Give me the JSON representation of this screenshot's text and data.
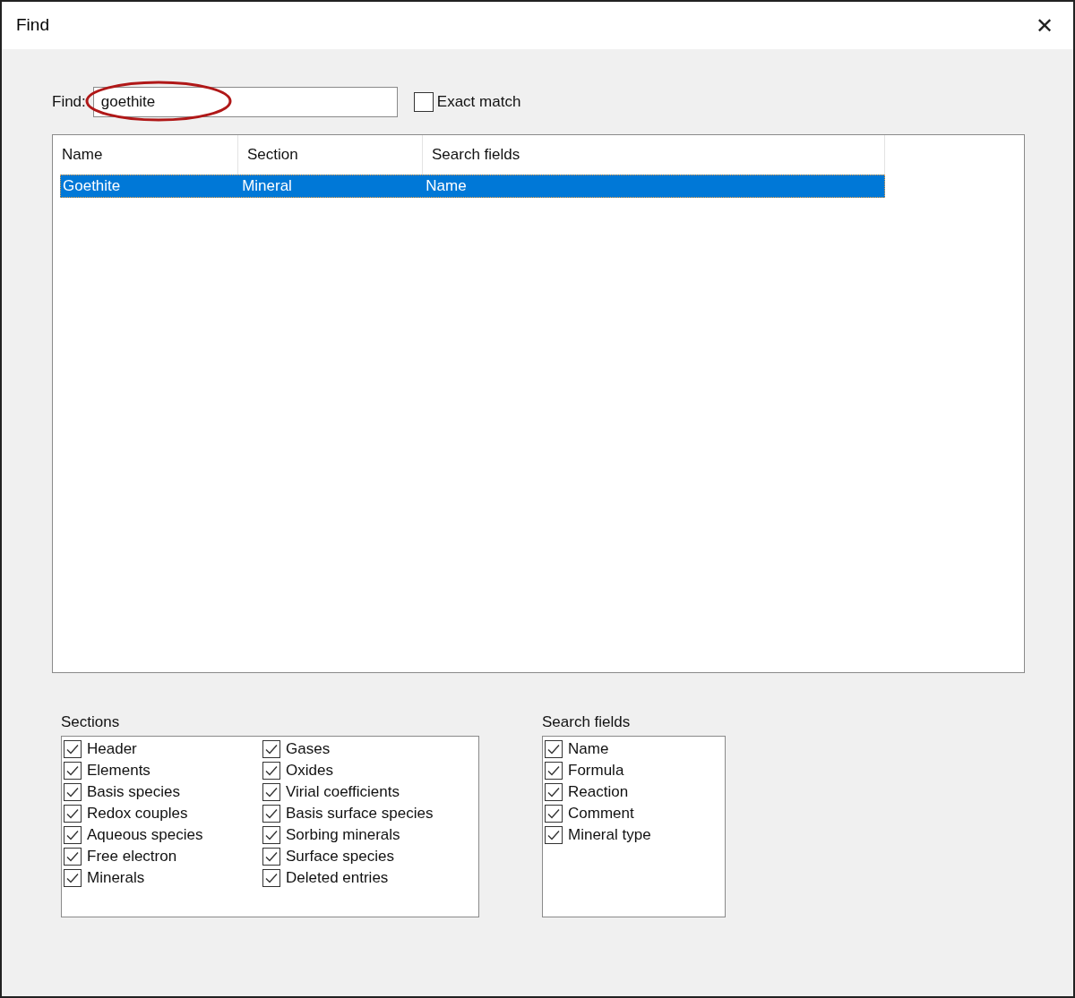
{
  "window": {
    "title": "Find",
    "close": "✕"
  },
  "find": {
    "label": "Find:",
    "value": "goethite"
  },
  "exact_match": {
    "label": "Exact match",
    "checked": false
  },
  "results": {
    "columns": [
      "Name",
      "Section",
      "Search fields"
    ],
    "rows": [
      {
        "cells": [
          "Goethite",
          "Mineral",
          "Name"
        ],
        "selected": true
      }
    ]
  },
  "sections": {
    "label": "Sections",
    "items": [
      {
        "label": "Header",
        "checked": true
      },
      {
        "label": "Elements",
        "checked": true
      },
      {
        "label": "Basis species",
        "checked": true
      },
      {
        "label": "Redox couples",
        "checked": true
      },
      {
        "label": "Aqueous species",
        "checked": true
      },
      {
        "label": "Free electron",
        "checked": true
      },
      {
        "label": "Minerals",
        "checked": true
      },
      {
        "label": "Gases",
        "checked": true
      },
      {
        "label": "Oxides",
        "checked": true
      },
      {
        "label": "Virial coefficients",
        "checked": true
      },
      {
        "label": "Basis surface species",
        "checked": true
      },
      {
        "label": "Sorbing minerals",
        "checked": true
      },
      {
        "label": "Surface species",
        "checked": true
      },
      {
        "label": "Deleted entries",
        "checked": true
      }
    ]
  },
  "search_fields": {
    "label": "Search fields",
    "items": [
      {
        "label": "Name",
        "checked": true
      },
      {
        "label": "Formula",
        "checked": true
      },
      {
        "label": "Reaction",
        "checked": true
      },
      {
        "label": "Comment",
        "checked": true
      },
      {
        "label": "Mineral type",
        "checked": true
      }
    ]
  }
}
